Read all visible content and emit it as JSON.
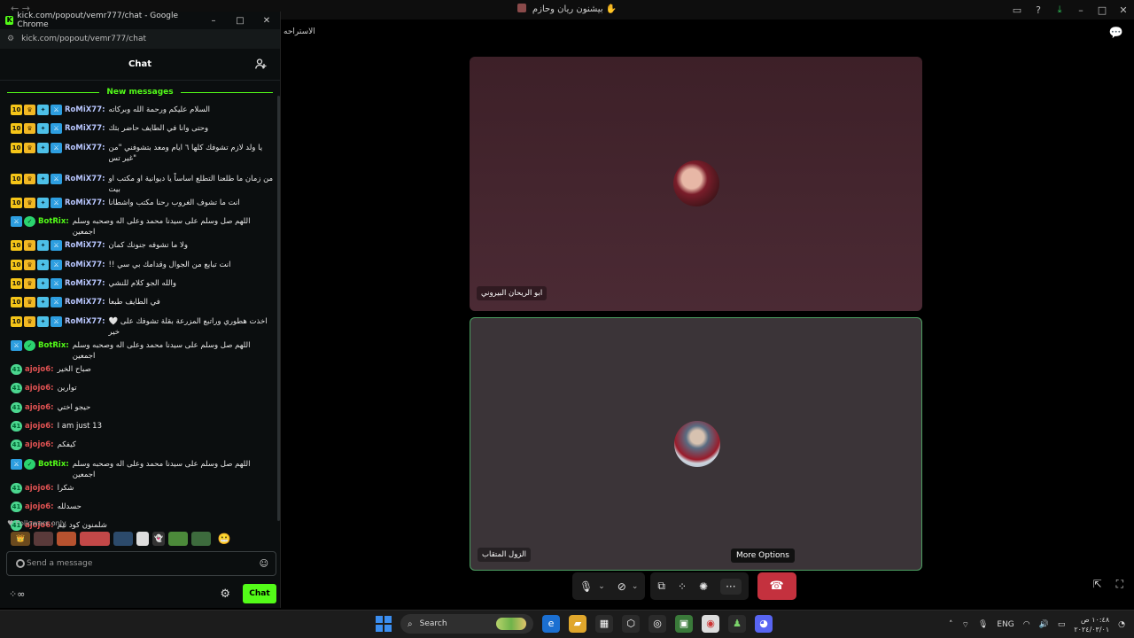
{
  "browser_top": {
    "title": "بيشنون ريان وحازم",
    "title_emoji": "✋"
  },
  "side_label": "الاستراحه",
  "popout": {
    "window_title": "kick.com/popout/vemr777/chat - Google Chrome",
    "url": "kick.com/popout/vemr777/chat",
    "chat_title": "Chat",
    "new_messages_label": "New messages",
    "followers_only": "Followers only",
    "input_placeholder": "Send a message",
    "send_label": "Chat",
    "messages": [
      {
        "user": "RoMiX77:",
        "badges": [
          "sub",
          "crown",
          "vip",
          "mod"
        ],
        "text": "السلام عليكم ورحمة الله وبركاته"
      },
      {
        "user": "RoMiX77:",
        "badges": [
          "sub",
          "crown",
          "vip",
          "mod"
        ],
        "text": "وحتى وانا في الطايف حاضر بثك"
      },
      {
        "user": "RoMiX77:",
        "badges": [
          "sub",
          "crown",
          "vip",
          "mod"
        ],
        "text": "يا ولد لازم تشوفك كلها ٦ ايام ومعد بتشوفني \"من غير تس\"",
        "tall": true
      },
      {
        "user": "RoMiX77:",
        "badges": [
          "sub",
          "crown",
          "vip",
          "mod"
        ],
        "text": "من زمان ما طلعنا التطلع اساساً يا ديوانية او مكتب او بيت"
      },
      {
        "user": "RoMiX77:",
        "badges": [
          "sub",
          "crown",
          "vip",
          "mod"
        ],
        "text": "انت ما تشوف الغروب رحنا مكتب واشطانا"
      },
      {
        "user": "BotRix:",
        "badges": [
          "mod",
          "ok"
        ],
        "text": "اللهم صل وسلم على سيدنا محمد وعلى اله وصحبه وسلم اجمعين"
      },
      {
        "user": "RoMiX77:",
        "badges": [
          "sub",
          "crown",
          "vip",
          "mod"
        ],
        "text": "ولا ما تشوفه جنونك كمان"
      },
      {
        "user": "RoMiX77:",
        "badges": [
          "sub",
          "crown",
          "vip",
          "mod"
        ],
        "text": "!! انت تبايع من الجوال وقدامك بي سي"
      },
      {
        "user": "RoMiX77:",
        "badges": [
          "sub",
          "crown",
          "vip",
          "mod"
        ],
        "text": "والله الجو كلام للنشي"
      },
      {
        "user": "RoMiX77:",
        "badges": [
          "sub",
          "crown",
          "vip",
          "mod"
        ],
        "text": "في الطايف طبعا"
      },
      {
        "user": "RoMiX77:",
        "badges": [
          "sub",
          "crown",
          "vip",
          "mod"
        ],
        "text": "🤍 اخذت هطوري وراتبع المزرعة بقلة تشوفك على خير"
      },
      {
        "user": "BotRix:",
        "badges": [
          "mod",
          "ok"
        ],
        "text": "اللهم صل وسلم على سيدنا محمد وعلى اله وصحبه وسلم اجمعين"
      },
      {
        "user": "ajojo6:",
        "badges": [
          "og"
        ],
        "text": "صباح الخير"
      },
      {
        "user": "ajojo6:",
        "badges": [
          "og"
        ],
        "text": "توارين"
      },
      {
        "user": "ajojo6:",
        "badges": [
          "og"
        ],
        "text": "حيجو اختي"
      },
      {
        "user": "ajojo6:",
        "badges": [
          "og"
        ],
        "text": "I am just 13"
      },
      {
        "user": "ajojo6:",
        "badges": [
          "og"
        ],
        "text": "كيفكم"
      },
      {
        "user": "BotRix:",
        "badges": [
          "mod",
          "ok"
        ],
        "text": "اللهم صل وسلم على سيدنا محمد وعلى اله وصحبه وسلم اجمعين"
      },
      {
        "user": "ajojo6:",
        "badges": [
          "og"
        ],
        "text": "شكرا"
      },
      {
        "user": "ajojo6:",
        "badges": [
          "og"
        ],
        "text": "حسدلله"
      },
      {
        "user": "ajojo6:",
        "badges": [
          "og"
        ],
        "text": "شلمنون كود نيم"
      }
    ],
    "badge_text": {
      "sub": "10",
      "crown": "♛",
      "vip": "✦",
      "mod": "⚔",
      "ok": "✓",
      "og": "41"
    }
  },
  "call": {
    "top_participant": "ابو الريحان البيروني",
    "bottom_participant": "الزول المتقاب",
    "tooltip": "More Options"
  },
  "taskbar": {
    "search_label": "Search",
    "lang": "ENG",
    "time": "١٠:٤٨ ص",
    "date": "٢٠٢٤/٠٣/٠١"
  },
  "colors": {
    "kick_green": "#53fc18",
    "end_call_red": "#c4313e",
    "active_tile_border": "#4c9e61"
  }
}
